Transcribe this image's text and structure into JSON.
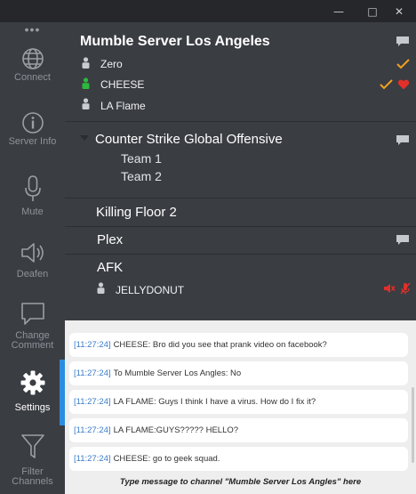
{
  "window": {
    "minimize_glyph": "—",
    "maximize_glyph": "□",
    "close_glyph": "✕"
  },
  "sidebar": {
    "dots": "•••",
    "items": [
      {
        "label": "Connect",
        "icon": "globe-icon"
      },
      {
        "label": "Server Info",
        "icon": "info-icon"
      },
      {
        "label": "Mute",
        "icon": "microphone-icon"
      },
      {
        "label": "Deafen",
        "icon": "speaker-icon"
      },
      {
        "label": "Change Comment",
        "icon": "speech-bubble-icon"
      },
      {
        "label": "Settings",
        "icon": "gear-icon",
        "active": true
      },
      {
        "label": "Filter Channels",
        "icon": "funnel-icon"
      }
    ]
  },
  "server": {
    "name": "Mumble Server Los Angeles",
    "users": [
      {
        "name": "Zero",
        "status": "talking-off",
        "badges": [
          "check"
        ]
      },
      {
        "name": "CHEESE",
        "status": "talking",
        "badges": [
          "check",
          "heart"
        ]
      },
      {
        "name": "LA Flame",
        "status": "idle",
        "badges": []
      }
    ],
    "channels": [
      {
        "name": "Counter Strike Global Offensive",
        "expanded": true,
        "subchannels": [
          "Team 1",
          "Team 2"
        ],
        "has_comment": true
      },
      {
        "name": "Killing Floor 2",
        "has_comment": false
      },
      {
        "name": "Plex",
        "has_comment": true
      },
      {
        "name": "AFK",
        "has_comment": false,
        "users": [
          {
            "name": "JELLYDONUT",
            "badges": [
              "muted",
              "deafened"
            ]
          }
        ]
      }
    ]
  },
  "chat": {
    "messages": [
      {
        "time": "[11:27:24]",
        "text": "CHEESE: Bro did you see that prank video on facebook?"
      },
      {
        "time": "[11:27:24]",
        "text": "To Mumble Server Los Angles: No"
      },
      {
        "time": "[11:27:24]",
        "text": "LA FLAME: Guys I think I have a virus. How do I fix it?"
      },
      {
        "time": "[11:27:24]",
        "text": "LA FLAME:GUYS????? HELLO?"
      },
      {
        "time": "[11:27:24]",
        "text": "CHEESE: go to geek squad."
      }
    ],
    "input_placeholder": "Type message to channel \"Mumble Server Los Angles\" here"
  },
  "colors": {
    "accent": "#2b8de0",
    "check": "#f0a020",
    "heart": "#e0302a",
    "talking": "#2db83d",
    "muted": "#e0302a"
  }
}
